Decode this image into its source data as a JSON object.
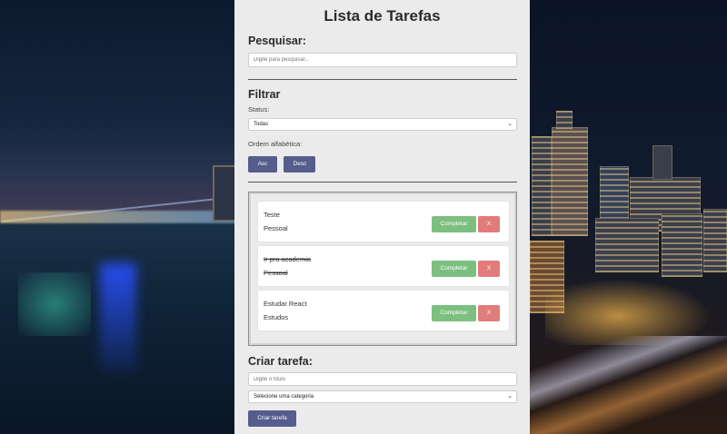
{
  "app": {
    "title": "Lista de Tarefas"
  },
  "search": {
    "heading": "Pesquisar:",
    "placeholder": "Digite para pesquisar..."
  },
  "filter": {
    "heading": "Filtrar",
    "status_label": "Status:",
    "status_selected": "Todas",
    "order_label": "Ordem alfabética:",
    "asc_label": "Asc",
    "desc_label": "Desc"
  },
  "tasks": [
    {
      "name": "Teste",
      "category": "Pessoal",
      "completed": false,
      "complete_label": "Completar",
      "remove_label": "X"
    },
    {
      "name": "Ir pra academia",
      "category": "Pessoal",
      "completed": true,
      "complete_label": "Completar",
      "remove_label": "X"
    },
    {
      "name": "Estudar React",
      "category": "Estudos",
      "completed": false,
      "complete_label": "Completar",
      "remove_label": "X"
    }
  ],
  "create": {
    "heading": "Criar tarefa:",
    "title_placeholder": "Digite o título",
    "category_selected": "Selecione uma categoria",
    "submit_label": "Criar tarefa"
  },
  "icons": {
    "select_chevron": "chevron-down-icon"
  },
  "colors": {
    "primary": "#565c8c",
    "complete": "#7cbf7f",
    "remove": "#e07c7a",
    "panel": "#ebebeb"
  }
}
